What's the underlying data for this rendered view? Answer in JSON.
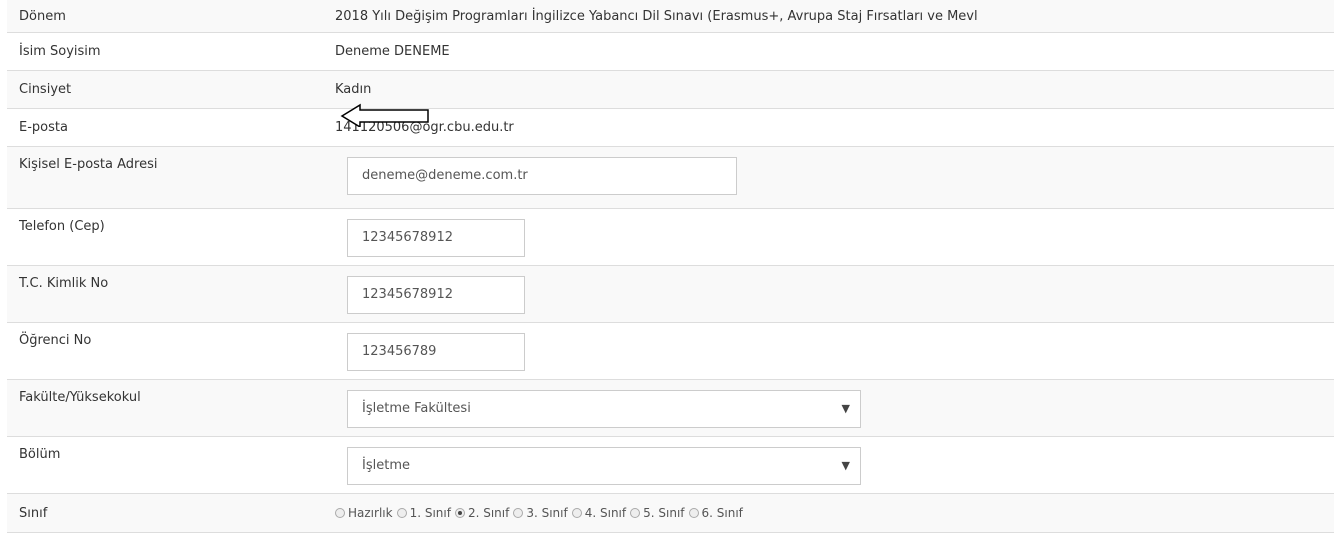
{
  "rows": {
    "donem": {
      "label": "Dönem",
      "value": "2018 Yılı Değişim Programları İngilizce Yabancı Dil Sınavı (Erasmus+, Avrupa Staj Fırsatları ve Mevl"
    },
    "isim": {
      "label": "İsim Soyisim",
      "value": "Deneme DENEME"
    },
    "cinsiyet": {
      "label": "Cinsiyet",
      "value": "Kadın"
    },
    "eposta": {
      "label": "E-posta",
      "value": "141120506@ogr.cbu.edu.tr"
    },
    "kisisel_eposta": {
      "label": "Kişisel E-posta Adresi",
      "value": "deneme@deneme.com.tr"
    },
    "telefon": {
      "label": "Telefon (Cep)",
      "value": "12345678912"
    },
    "tc": {
      "label": "T.C. Kimlik No",
      "value": "12345678912"
    },
    "ogrenci_no": {
      "label": "Öğrenci No",
      "value": "123456789"
    },
    "fakulte": {
      "label": "Fakülte/Yüksekokul",
      "value": "İşletme Fakültesi"
    },
    "bolum": {
      "label": "Bölüm",
      "value": "İşletme"
    },
    "sinif": {
      "label": "Sınıf",
      "options": [
        "Hazırlık",
        "1. Sınıf",
        "2. Sınıf",
        "3. Sınıf",
        "4. Sınıf",
        "5. Sınıf",
        "6. Sınıf"
      ],
      "selected": "2. Sınıf"
    }
  },
  "icons": {
    "caret": "chevron-down-icon",
    "pointer": "left-arrow-icon"
  }
}
